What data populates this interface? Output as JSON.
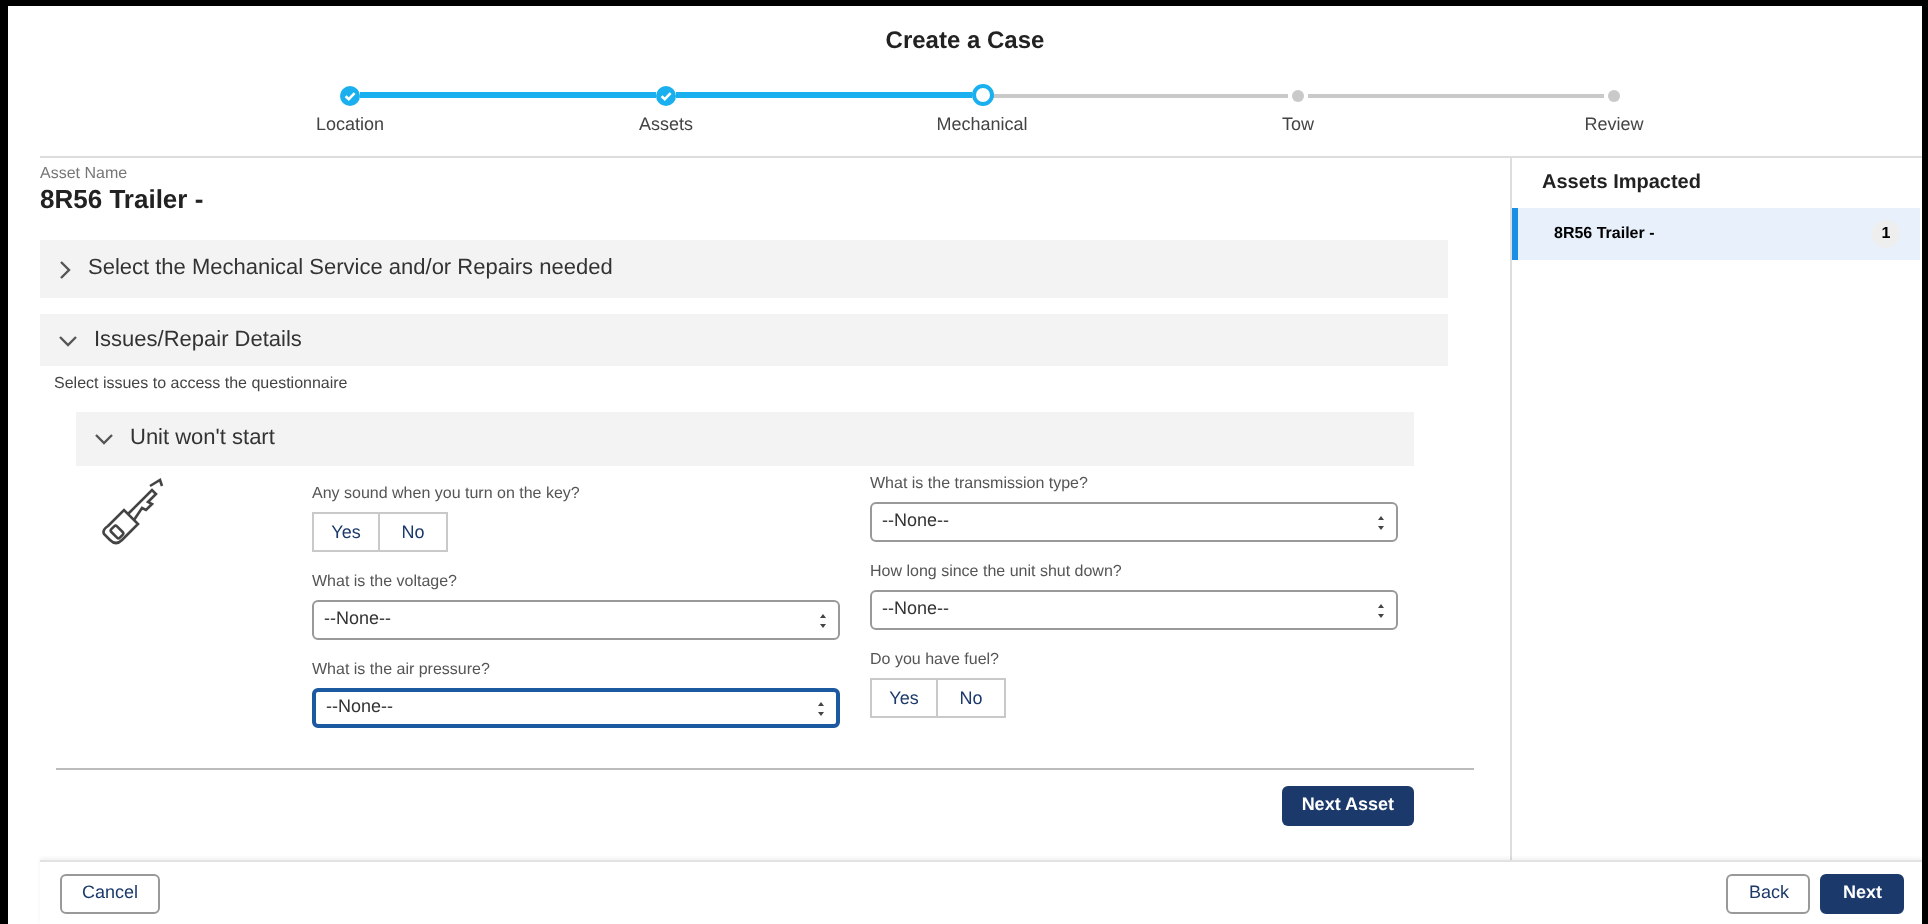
{
  "title": "Create a Case",
  "steps": [
    {
      "label": "Location",
      "completed": true,
      "selected": false
    },
    {
      "label": "Assets",
      "completed": true,
      "selected": false
    },
    {
      "label": "Mechanical",
      "completed": false,
      "selected": true
    },
    {
      "label": "Tow",
      "completed": false,
      "selected": false
    },
    {
      "label": "Review",
      "completed": false,
      "selected": false
    }
  ],
  "asset": {
    "label": "Asset Name",
    "value": "8R56 Trailer -"
  },
  "sections": [
    {
      "title": "Select the Mechanical Service and/or Repairs needed",
      "expanded": false
    },
    {
      "title": "Issues/Repair Details",
      "expanded": true
    }
  ],
  "hint": "Select issues to access the questionnaire",
  "issue": {
    "title": "Unit won't start",
    "expanded": true
  },
  "columns": [
    [
      {
        "kind": "toggle",
        "label": "Any sound when you turn on the key?",
        "options": [
          {
            "label": "Yes",
            "selected": false
          },
          {
            "label": "No",
            "selected": false
          }
        ]
      },
      {
        "kind": "select",
        "label": "What is the voltage?",
        "value": "--None--",
        "focused": false
      },
      {
        "kind": "select",
        "label": "What is the air pressure?",
        "value": "--None--",
        "focused": true
      }
    ],
    [
      {
        "kind": "select",
        "label": "What is the transmission type?",
        "value": "--None--",
        "focused": false
      },
      {
        "kind": "select",
        "label": "How long since the unit shut down?",
        "value": "--None--",
        "focused": false
      },
      {
        "kind": "toggle",
        "label": "Do you have fuel?",
        "options": [
          {
            "label": "Yes",
            "selected": false
          },
          {
            "label": "No",
            "selected": false
          }
        ]
      }
    ]
  ],
  "next_asset_button": "Next Asset",
  "sidebar": {
    "title": "Assets Impacted",
    "items": [
      {
        "label": "8R56 Trailer -",
        "count": "1",
        "selected": true
      }
    ]
  },
  "footer": {
    "cancel": "Cancel",
    "back": "Back",
    "next": "Next"
  }
}
